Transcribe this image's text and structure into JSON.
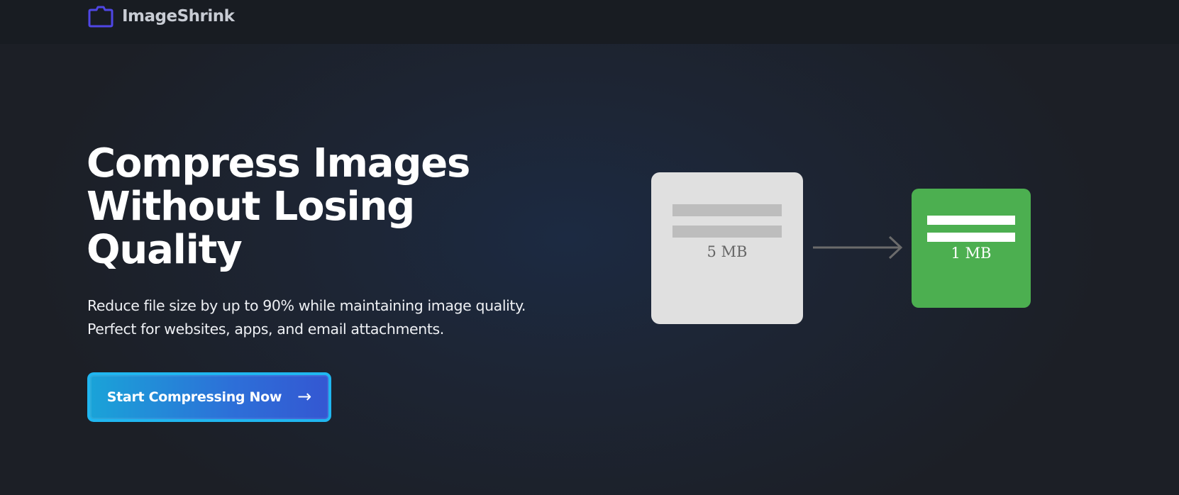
{
  "header": {
    "brand_name": "ImageShrink",
    "logo_icon": "camera-icon",
    "logo_color": "#4f46e5"
  },
  "hero": {
    "title": "Compress Images Without Losing Quality",
    "subtitle": "Reduce file size by up to 90% while maintaining image quality. Perfect for websites, apps, and email attachments.",
    "cta": {
      "label": "Start Compressing Now",
      "arrow": "→",
      "gradient_start": "#1aa3d8",
      "gradient_end": "#3457d2",
      "border_color": "#20b6f0"
    }
  },
  "illustration": {
    "original": {
      "size_label": "5 MB",
      "card_color": "#e0e0e0"
    },
    "arrow_icon": "arrow-right-icon",
    "compressed": {
      "size_label": "1 MB",
      "card_color": "#4caf50"
    }
  }
}
